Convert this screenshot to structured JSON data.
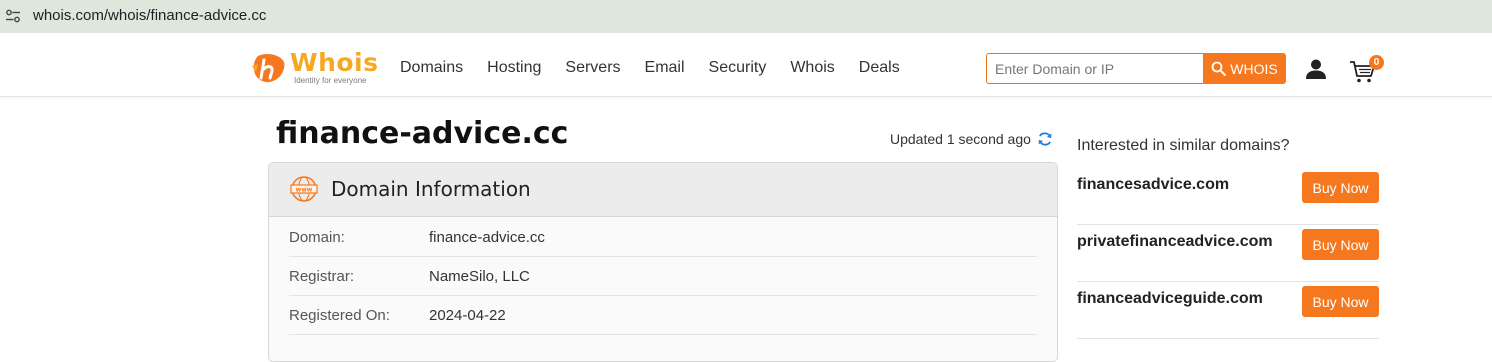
{
  "browser": {
    "url": "whois.com/whois/finance-advice.cc"
  },
  "header": {
    "logo": {
      "name": "Whois",
      "tagline": "Identity for everyone"
    },
    "nav": [
      "Domains",
      "Hosting",
      "Servers",
      "Email",
      "Security",
      "Whois",
      "Deals"
    ],
    "search": {
      "placeholder": "Enter Domain or IP",
      "button_label": "WHOIS"
    },
    "cart_count": "0"
  },
  "main": {
    "domain_title": "finance-advice.cc",
    "updated": "Updated 1 second ago",
    "panel": {
      "title": "Domain Information",
      "rows": [
        {
          "key": "Domain:",
          "value": "finance-advice.cc"
        },
        {
          "key": "Registrar:",
          "value": "NameSilo, LLC"
        },
        {
          "key": "Registered On:",
          "value": "2024-04-22"
        }
      ]
    }
  },
  "sidebar": {
    "heading": "Interested in similar domains?",
    "suggestions": [
      {
        "name": "financesadvice.com",
        "button": "Buy Now"
      },
      {
        "name": "privatefinanceadvice.com",
        "button": "Buy Now"
      },
      {
        "name": "financeadviceguide.com",
        "button": "Buy Now"
      }
    ]
  },
  "colors": {
    "accent": "#f5781e",
    "logo": "#f7a823",
    "address_bar": "#dfe7dc"
  }
}
